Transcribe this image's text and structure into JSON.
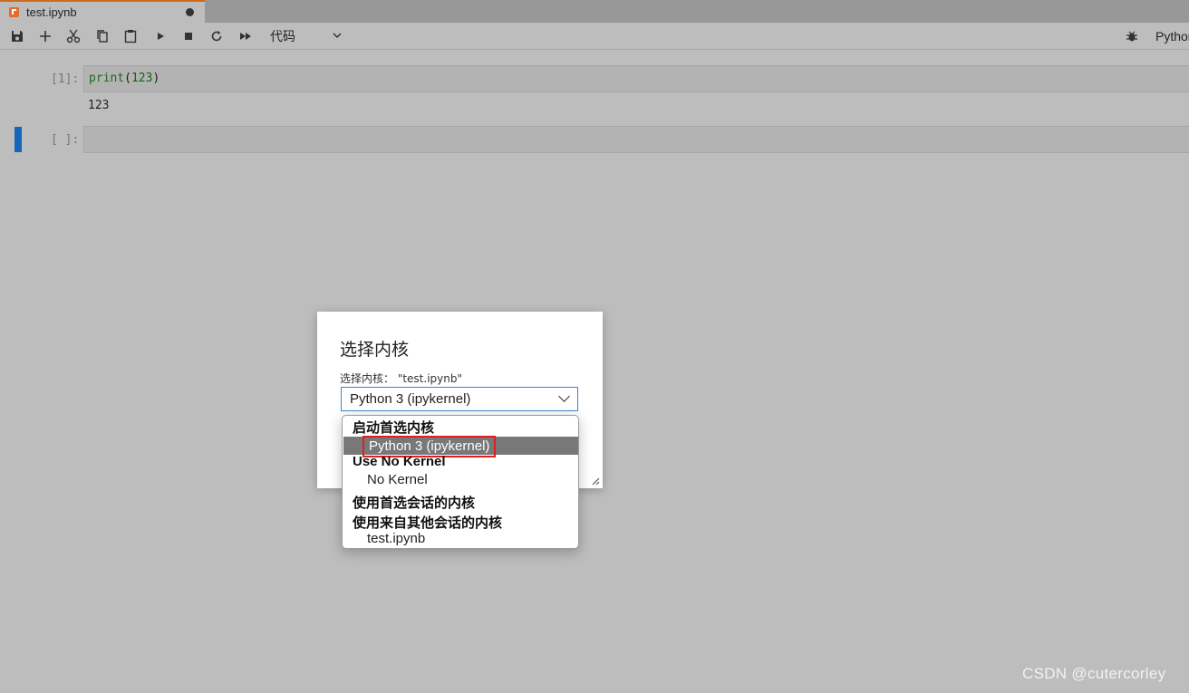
{
  "tab": {
    "title": "test.ipynb",
    "icon": "notebook-icon",
    "unsaved_indicator": "dot-icon"
  },
  "toolbar": {
    "buttons": [
      "save-icon",
      "plus-icon",
      "cut-icon",
      "copy-icon",
      "paste-icon",
      "run-icon",
      "stop-icon",
      "restart-icon",
      "fast-forward-icon"
    ],
    "cell_type": "代码",
    "kernel_name": "Python"
  },
  "cells": [
    {
      "prompt": "[1]:",
      "code_fn": "print",
      "code_open": "(",
      "code_arg": "123",
      "code_close": ")",
      "output": "123"
    },
    {
      "prompt": "[ ]:",
      "code": ""
    }
  ],
  "dialog": {
    "title": "选择内核",
    "label": "选择内核： \"test.ipynb\"",
    "selected": "Python 3 (ipykernel)"
  },
  "dropdown": {
    "group1": "启动首选内核",
    "opt1": "Python 3 (ipykernel)",
    "group2": "Use No Kernel",
    "opt2": "No Kernel",
    "group3": "使用首选会话的内核",
    "group4": "使用来自其他会话的内核",
    "opt4": "test.ipynb"
  },
  "watermark": "CSDN @cutercorley",
  "colors": {
    "accent": "#1565b8",
    "highlight": "#e02020",
    "tab_border": "#d06a1a"
  }
}
